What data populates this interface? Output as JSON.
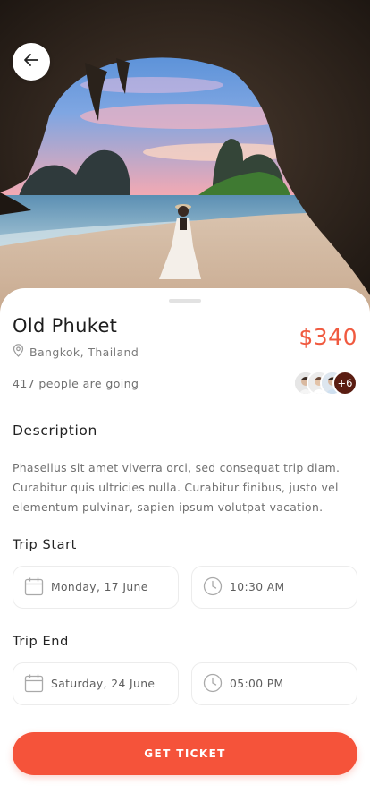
{
  "trip": {
    "title": "Old Phuket",
    "price": "$340",
    "location": "Bangkok, Thailand",
    "going_text": "417 people are going",
    "extra_count": "+6"
  },
  "description": {
    "heading": "Description",
    "body": "Phasellus sit amet viverra orci, sed consequat trip diam. Curabitur quis ultricies nulla. Curabitur finibus, justo vel elementum pulvinar, sapien ipsum volutpat vacation."
  },
  "trip_start": {
    "heading": "Trip Start",
    "date": "Monday, 17 June",
    "time": "10:30 AM"
  },
  "trip_end": {
    "heading": "Trip End",
    "date": "Saturday, 24 June",
    "time": "05:00 PM"
  },
  "cta": {
    "label": "GET TICKET"
  },
  "icons": {
    "back": "arrow-left-icon",
    "location": "location-pin-icon",
    "calendar": "calendar-icon",
    "clock": "clock-icon"
  },
  "colors": {
    "accent": "#f5533a",
    "price": "#f05a40",
    "avatar_more_bg": "#5a1d12"
  }
}
